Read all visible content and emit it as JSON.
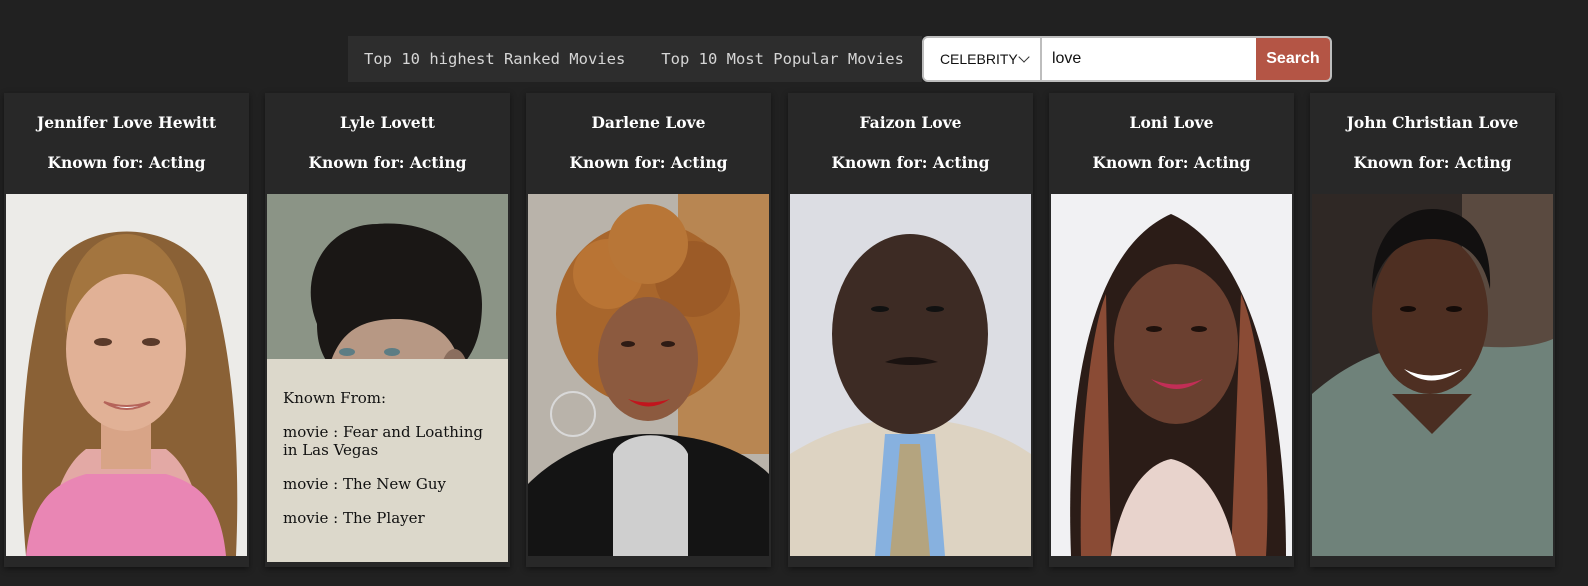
{
  "nav": {
    "links": [
      "Top 10 highest Ranked Movies",
      "Top 10 Most Popular Movies"
    ]
  },
  "search": {
    "category": "CELEBRITY",
    "query": "love",
    "button_label": "Search"
  },
  "cards": [
    {
      "name": "Jennifer Love Hewitt",
      "known_for": "Known for: Acting"
    },
    {
      "name": "Lyle Lovett",
      "known_for": "Known for: Acting"
    },
    {
      "name": "Darlene Love",
      "known_for": "Known for: Acting"
    },
    {
      "name": "Faizon Love",
      "known_for": "Known for: Acting"
    },
    {
      "name": "Loni Love",
      "known_for": "Known for: Acting"
    },
    {
      "name": "John Christian Love",
      "known_for": "Known for: Acting"
    }
  ],
  "hover_overlay": {
    "heading": "Known From:",
    "items": [
      "movie : Fear and Loathing in Las Vegas",
      "movie : The New Guy",
      "movie : The Player"
    ]
  }
}
